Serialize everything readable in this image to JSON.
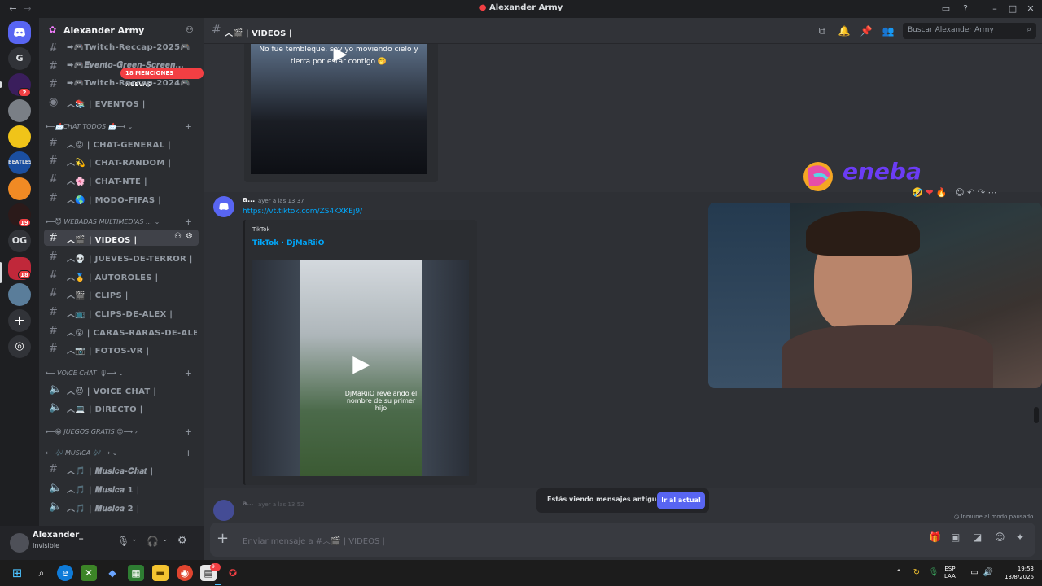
{
  "window": {
    "title": "Alexander Army"
  },
  "rail": {
    "servers": [
      {
        "label": "G",
        "badge": ""
      },
      {
        "label": "",
        "badge": "2"
      },
      {
        "label": "",
        "badge": ""
      },
      {
        "label": "",
        "badge": ""
      },
      {
        "label": "",
        "badge": ""
      },
      {
        "label": "",
        "badge": ""
      },
      {
        "label": "",
        "badge": "19"
      },
      {
        "label": "OG",
        "badge": ""
      },
      {
        "label": "",
        "badge": "18"
      },
      {
        "label": "",
        "badge": ""
      }
    ]
  },
  "sidebar": {
    "server_name": "Alexander Army",
    "mentions_pill": "18 MENCIONES NUEVAS",
    "channels_top": [
      {
        "label": "➡🎮Twitch-Reccap-2025🎮"
      },
      {
        "label": "➡🎮𝑬𝒗𝒆𝒏𝒕𝒐-𝑮𝒓𝒆𝒆𝒏-𝑺𝒄𝒓𝒆𝒆𝒏…"
      },
      {
        "label": "➡🎮Twitch-Reccap-2024🎮"
      },
      {
        "label": "︿📚 | EVENTOS |"
      }
    ],
    "cat_chat": "⟵📩CHAT TODOS 📩⟶",
    "chat_channels": [
      {
        "label": "︿😡 | CHAT-GENERAL |"
      },
      {
        "label": "︿💫 | CHAT-RANDOM |"
      },
      {
        "label": "︿🌸 | CHAT-NTE |"
      },
      {
        "label": "︿🌎 | MODO-FIFAS |"
      }
    ],
    "cat_webadas": "⟵😈 WEBADAS MULTIMEDIAS …",
    "webadas_channels": [
      {
        "label": "︿🎬 | VIDEOS |"
      },
      {
        "label": "︿💀 | JUEVES-DE-TERROR |"
      },
      {
        "label": "︿🥇 | AUTOROLES |"
      },
      {
        "label": "︿🎬 | CLIPS |"
      },
      {
        "label": "︿📺 | CLIPS-DE-ALEX |"
      },
      {
        "label": "︿😮 | CARAS-RARAS-DE-ALE…"
      },
      {
        "label": "︿📷 | FOTOS-VR |"
      }
    ],
    "cat_voice": "⟵ VOICE CHAT 🎙⟶",
    "voice_channels": [
      {
        "label": "︿😈 | VOICE CHAT |"
      },
      {
        "label": "︿💻 | DIRECTO |"
      }
    ],
    "cat_juegos": "⟵😀 JUEGOS GRATIS 😍⟶",
    "cat_musica": "⟵🎶 MUSICA 🎶⟶",
    "music_channels": [
      {
        "label": "︿🎵 | 𝑴𝒖𝒔𝒊𝒄𝒂-𝑪𝒉𝒂𝒕 |"
      },
      {
        "label": "︿🎵 | 𝑴𝒖𝒔𝒊𝒄𝒂 1 |"
      },
      {
        "label": "︿🎵 | 𝑴𝒖𝒔𝒊𝒄𝒂 2 |"
      }
    ]
  },
  "user": {
    "name": "Alexander_",
    "status": "Invisible"
  },
  "topbar": {
    "channel": "︿🎬 | VIDEOS |",
    "search_placeholder": "Buscar Alexander Army"
  },
  "messages": {
    "video1_caption": "No fue tembleque, soy yo moviendo cielo y tierra por estar contigo 🤭",
    "msg2": {
      "author": "a…",
      "time": "ayer a las 13:37",
      "link": "https://vt.tiktok.com/ZS4KXKEj9/",
      "embed_provider": "TikTok",
      "embed_title": "TikTok · DjMaRiiO",
      "video_caption": "DjMaRiiO revelando el nombre de su primer hijo"
    },
    "msg3": {
      "author": "a…",
      "time": "ayer a las 13:52"
    }
  },
  "overlay": {
    "brand": "eneba"
  },
  "jump_bar": {
    "text": "Estás viendo mensajes antiguos",
    "button": "Ir al actual"
  },
  "immune": "Inmune al modo pausado",
  "composer": {
    "placeholder": "Enviar mensaje a #︿🎬 | VIDEOS |"
  },
  "taskbar": {
    "lang": "ESP",
    "lang2": "LAA",
    "time": "19:53",
    "date": "13/8/2026",
    "notif_badge": "9+"
  },
  "colors": {
    "accent": "#5865f2",
    "link": "#00a8fc",
    "danger": "#f23f43",
    "bg": "#313338"
  }
}
